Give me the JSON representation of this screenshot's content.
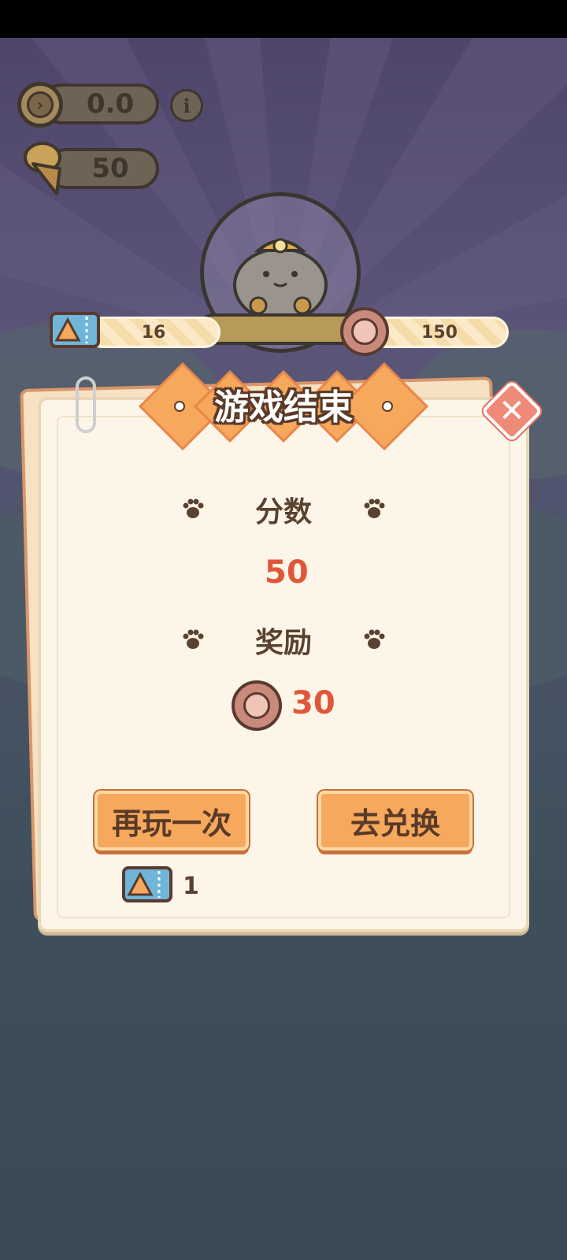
{
  "hud": {
    "timer_value": "0.0",
    "cone_count": "50",
    "timer_icon": "clock-icon",
    "info_icon": "info-icon"
  },
  "resources": {
    "tickets": "16",
    "coins": "150"
  },
  "dialog": {
    "title": "游戏结束",
    "score_label": "分数",
    "score_value": "50",
    "reward_label": "奖励",
    "reward_value": "30",
    "replay_button": "再玩一次",
    "exchange_button": "去兑换",
    "ticket_cost": "1"
  },
  "colors": {
    "accent_orange": "#f6a85c",
    "value_red": "#e0563a",
    "panel_bg": "#fdf6e8",
    "close_pink": "#f08a78"
  }
}
